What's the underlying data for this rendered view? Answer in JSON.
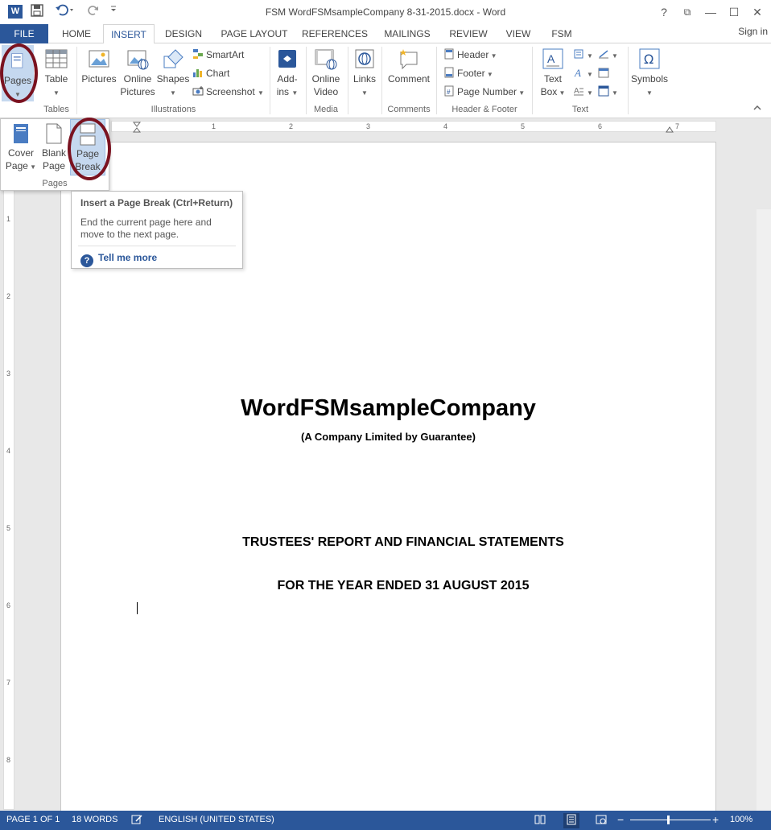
{
  "window": {
    "title": "FSM WordFSMsampleCompany 8-31-2015.docx - Word",
    "app_logo": "W",
    "help_glyph": "?",
    "ribbon_display_glyph": "⧉",
    "minimize_glyph": "—",
    "maximize_glyph": "☐",
    "close_glyph": "✕"
  },
  "tabs": [
    "FILE",
    "HOME",
    "INSERT",
    "DESIGN",
    "PAGE LAYOUT",
    "REFERENCES",
    "MAILINGS",
    "REVIEW",
    "VIEW",
    "FSM"
  ],
  "signin": "Sign in",
  "ribbon": {
    "pages": "Pages",
    "table": "Table",
    "pictures": "Pictures",
    "online_pictures_1": "Online",
    "online_pictures_2": "Pictures",
    "shapes": "Shapes",
    "smartart": "SmartArt",
    "chart": "Chart",
    "screenshot": "Screenshot",
    "addins_1": "Add-",
    "addins_2": "ins",
    "online_video_1": "Online",
    "online_video_2": "Video",
    "links": "Links",
    "comment": "Comment",
    "header": "Header",
    "footer": "Footer",
    "page_number": "Page Number",
    "textbox_1": "Text",
    "textbox_2": "Box",
    "symbols": "Symbols",
    "groups": {
      "tables": "Tables",
      "illustrations": "Illustrations",
      "media": "Media",
      "comments": "Comments",
      "header_footer": "Header & Footer",
      "text": "Text"
    }
  },
  "pages_dropdown": {
    "cover_1": "Cover",
    "cover_2": "Page",
    "blank_1": "Blank",
    "blank_2": "Page",
    "break_1": "Page",
    "break_2": "Break",
    "group": "Pages"
  },
  "tooltip": {
    "title": "Insert a Page Break (Ctrl+Return)",
    "body": "End the current page here and move to the next page.",
    "more": "Tell me more"
  },
  "ruler": {
    "h": [
      "1",
      "2",
      "3",
      "4",
      "5",
      "6",
      "7"
    ],
    "v": [
      "1",
      "2",
      "3",
      "4",
      "5",
      "6",
      "7",
      "8"
    ]
  },
  "document": {
    "title": "WordFSMsampleCompany",
    "subtitle": "(A Company Limited by Guarantee)",
    "heading1": "TRUSTEES' REPORT AND FINANCIAL STATEMENTS",
    "heading2": "FOR THE YEAR ENDED 31 AUGUST 2015"
  },
  "status": {
    "page": "PAGE 1 OF 1",
    "words": "18 WORDS",
    "language": "ENGLISH (UNITED STATES)",
    "zoom": "100%",
    "zoom_minus": "−",
    "zoom_plus": "+"
  },
  "colors": {
    "accent": "#2b579a",
    "annotation": "#7a1220"
  }
}
